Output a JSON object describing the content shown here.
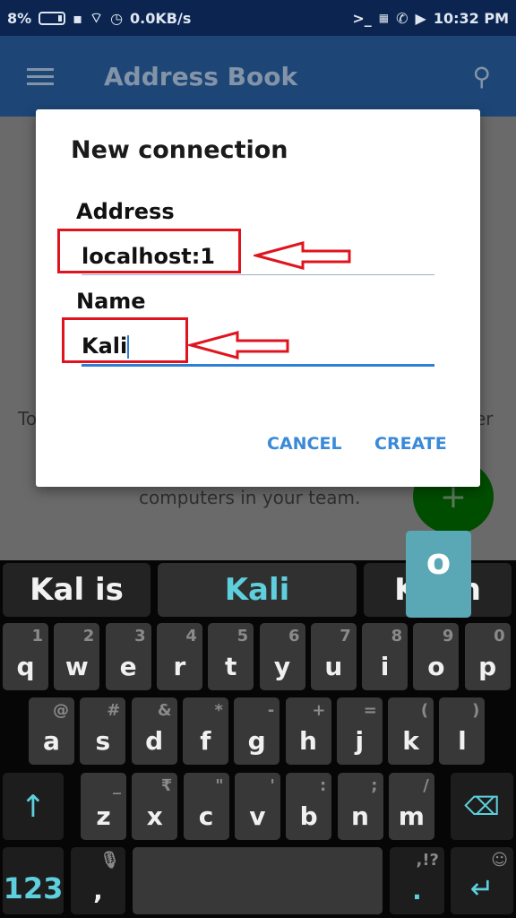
{
  "status_bar": {
    "battery": "8%",
    "network_speed": "0.0KB/s",
    "time": "10:32 PM",
    "icons": [
      "battery-icon",
      "sim-icon",
      "wifi-icon",
      "clock-icon",
      "terminal-icon",
      "keyboard-icon",
      "phone-icon",
      "youtube-icon"
    ]
  },
  "app_bar": {
    "title": "Address Book",
    "icons": [
      "menu-icon",
      "search-icon"
    ]
  },
  "background": {
    "text_left": "To",
    "text_right": "er",
    "text_line2": "computers in your team.",
    "fab_label": "+"
  },
  "dialog": {
    "title": "New connection",
    "address_label": "Address",
    "address_value": "localhost:1",
    "name_label": "Name",
    "name_value": "Kali",
    "cancel": "CANCEL",
    "create": "CREATE"
  },
  "keyboard": {
    "suggestions": [
      "Kal is",
      "Kali",
      "Kaon"
    ],
    "key_preview": "o",
    "row1": [
      [
        "q",
        "1"
      ],
      [
        "w",
        "2"
      ],
      [
        "e",
        "3"
      ],
      [
        "r",
        "4"
      ],
      [
        "t",
        "5"
      ],
      [
        "y",
        "6"
      ],
      [
        "u",
        "7"
      ],
      [
        "i",
        "8"
      ],
      [
        "o",
        "9"
      ],
      [
        "p",
        "0"
      ]
    ],
    "row2": [
      [
        "a",
        "@"
      ],
      [
        "s",
        "#"
      ],
      [
        "d",
        "&"
      ],
      [
        "f",
        "*"
      ],
      [
        "g",
        "-"
      ],
      [
        "h",
        "+"
      ],
      [
        "j",
        "="
      ],
      [
        "k",
        "("
      ],
      [
        "l",
        ")"
      ]
    ],
    "row3": [
      [
        "z",
        "_"
      ],
      [
        "x",
        "₹"
      ],
      [
        "c",
        "\""
      ],
      [
        "v",
        "'"
      ],
      [
        "b",
        ":"
      ],
      [
        "n",
        ";"
      ],
      [
        "m",
        "/"
      ]
    ],
    "numbers_key": "123",
    "comma": ",",
    "period": ".",
    "period_secondary": ",!?",
    "accent": "#5ecfdc"
  },
  "colors": {
    "highlight_box": "#e0141e",
    "dialog_button": "#3a8ad8"
  }
}
